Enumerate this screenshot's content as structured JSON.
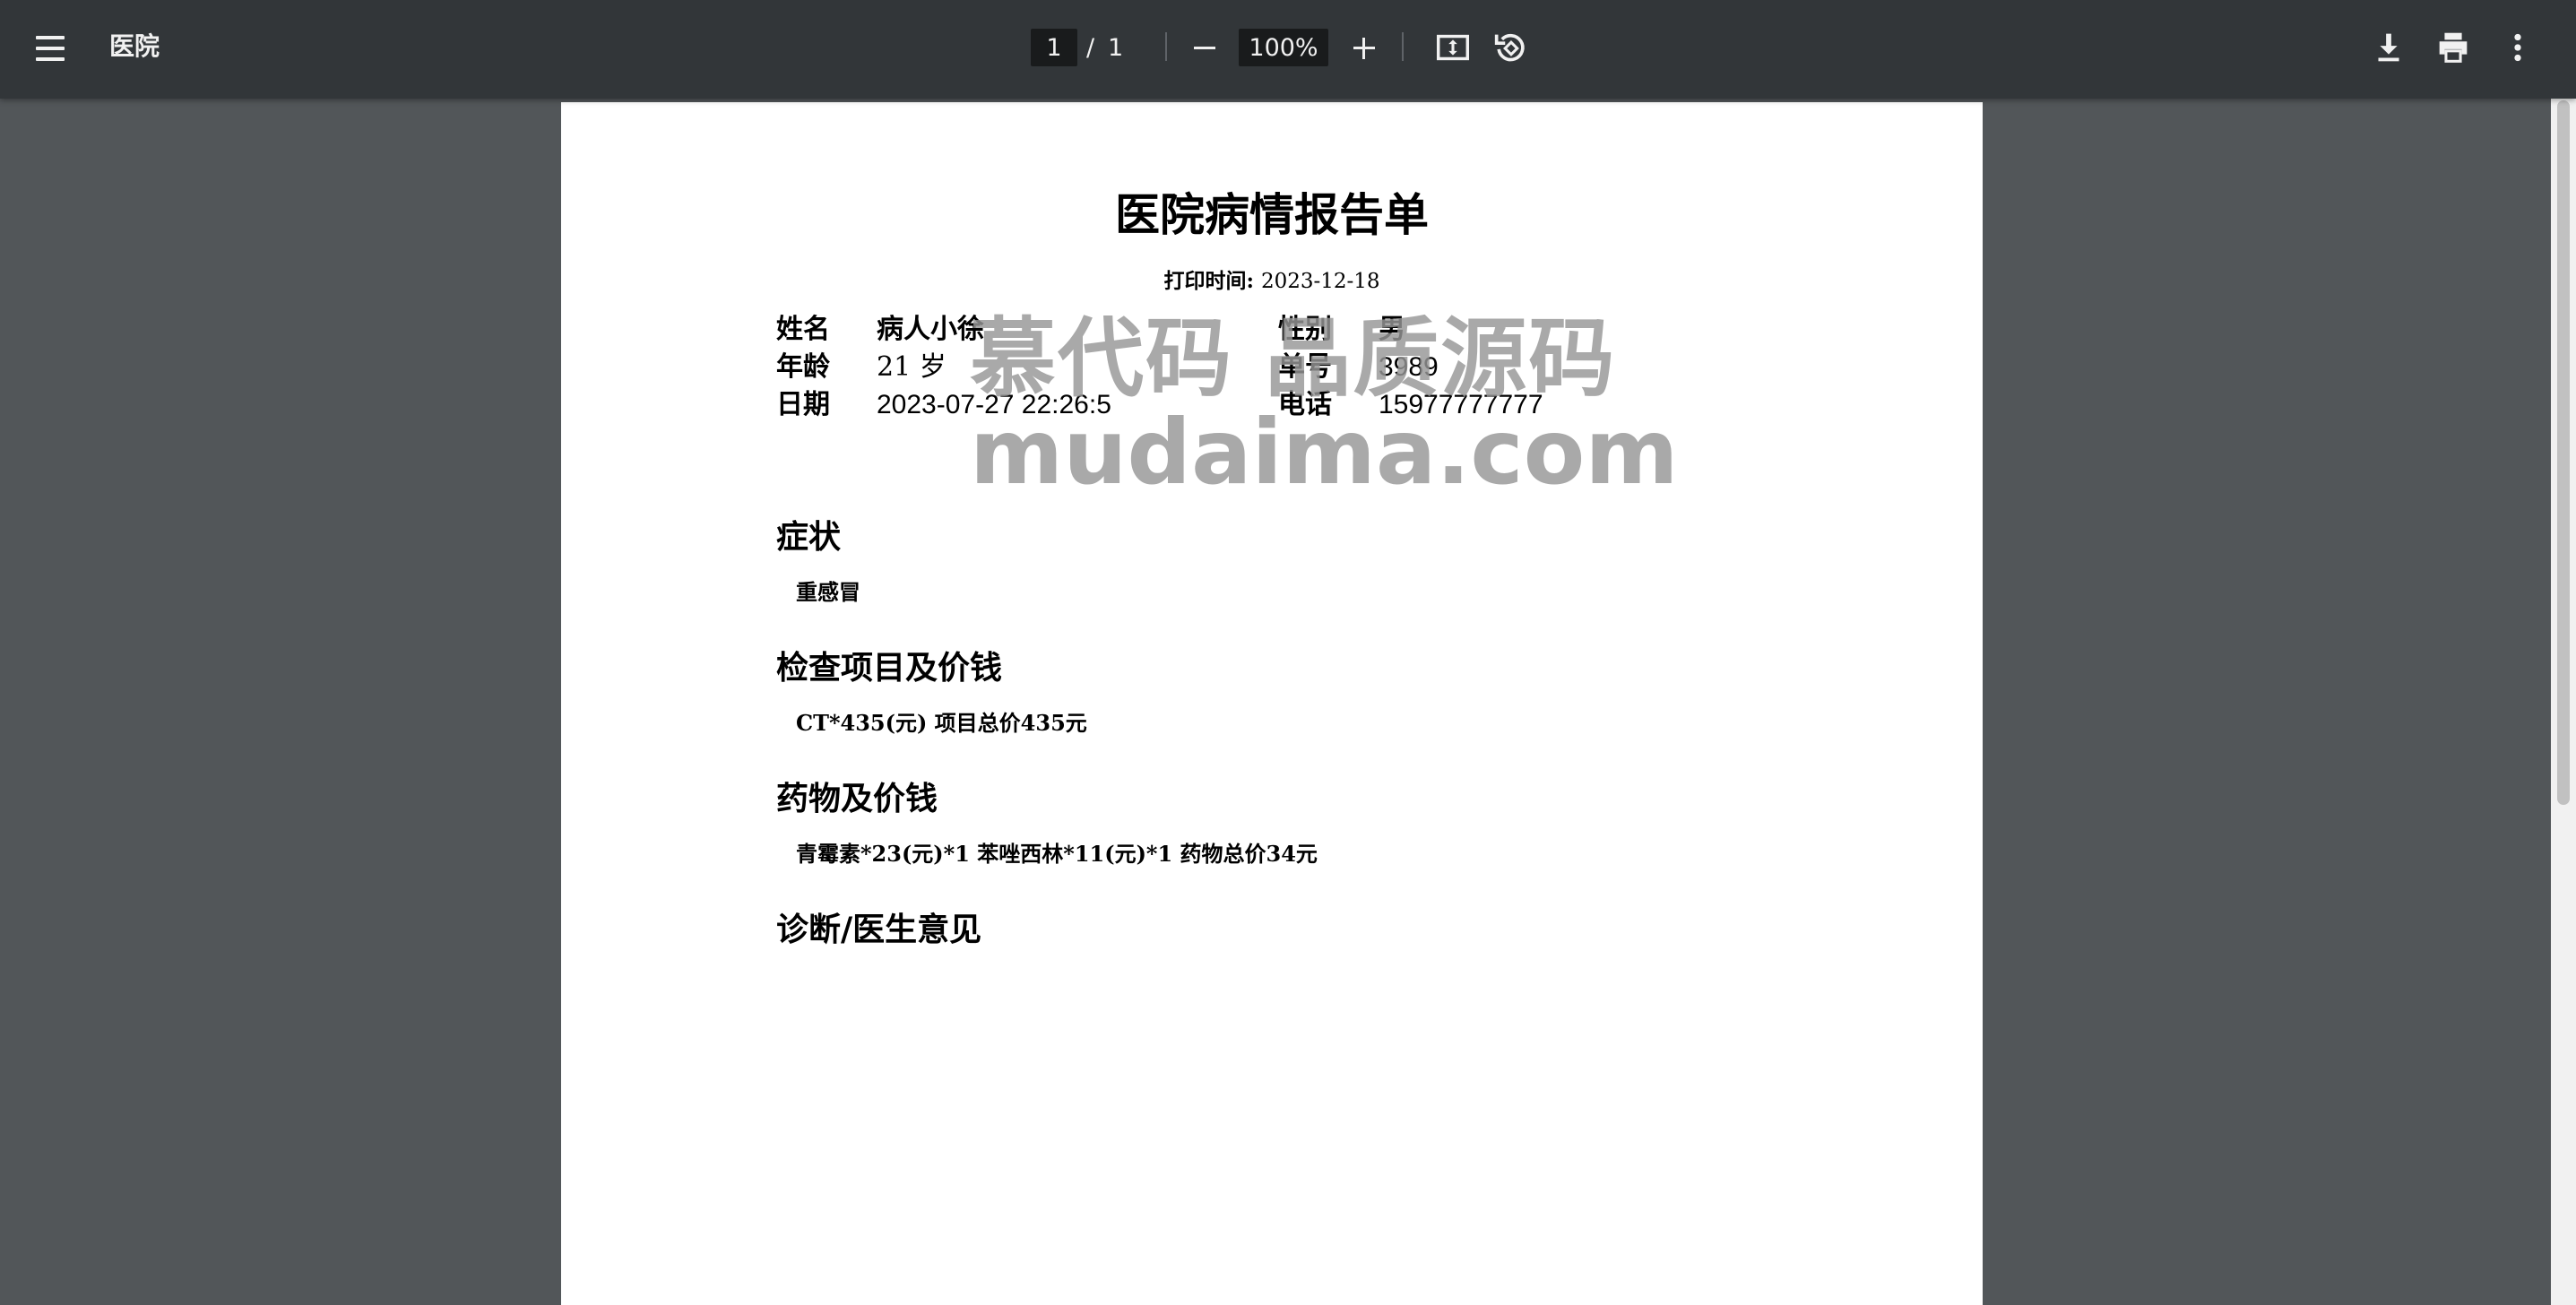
{
  "toolbar": {
    "title": "医院",
    "page_current": "1",
    "page_separator": "/",
    "page_total": "1",
    "zoom": "100%"
  },
  "document": {
    "title": "医院病情报告单",
    "print_time_label": "打印时间:",
    "print_time_value": "2023-12-18",
    "patient": {
      "name_label": "姓名",
      "name_value": "病人小徐",
      "gender_label": "性别",
      "gender_value": "男",
      "age_label": "年龄",
      "age_value": "21 岁",
      "order_label": "单号",
      "order_value": "3989",
      "date_label": "日期",
      "date_value": "2023-07-27 22:26:5",
      "phone_label": "电话",
      "phone_value": "15977777777"
    },
    "sections": [
      {
        "heading": "症状",
        "body": "重感冒"
      },
      {
        "heading": "检查项目及价钱",
        "body": "CT*435(元)  项目总价435元"
      },
      {
        "heading": "药物及价钱",
        "body": "青霉素*23(元)*1 苯唑西林*11(元)*1  药物总价34元"
      },
      {
        "heading": "诊断/医生意见",
        "body": ""
      }
    ]
  },
  "watermark": {
    "line1": "慕代码 品质源码",
    "line2": "mudaima.com"
  },
  "colors": {
    "toolbar_bg": "#323639",
    "viewer_bg": "#525659",
    "page_bg": "#ffffff",
    "input_bg": "#191b1c"
  },
  "icons": [
    "menu-icon",
    "minus-icon",
    "plus-icon",
    "fit-page-icon",
    "rotate-icon",
    "download-icon",
    "print-icon",
    "more-vert-icon"
  ]
}
